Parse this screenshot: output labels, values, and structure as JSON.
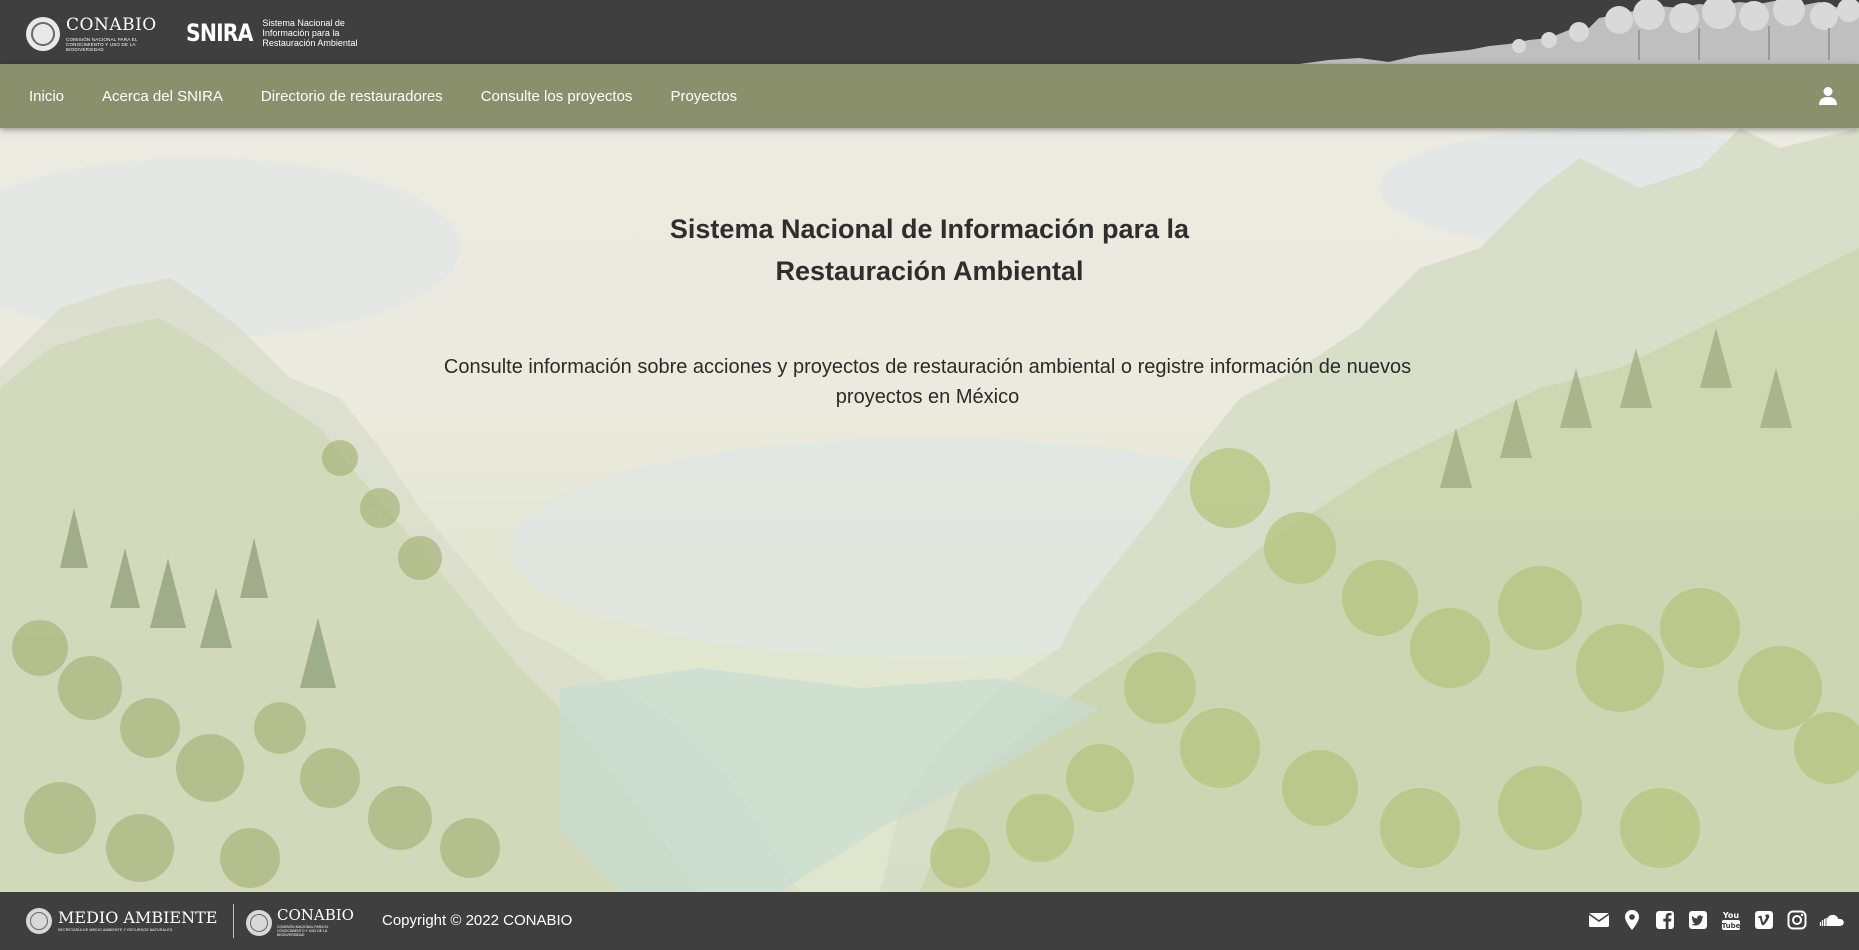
{
  "header": {
    "conabio_logo": {
      "word": "CONABIO",
      "sub": "COMISIÓN NACIONAL PARA EL CONOCIMIENTO Y USO DE LA BIODIVERSIDAD"
    },
    "snira_logo": {
      "word": "SNIRA",
      "sub": "Sistema Nacional de Información para la Restauración Ambiental"
    }
  },
  "nav": {
    "items": [
      {
        "label": "Inicio"
      },
      {
        "label": "Acerca del SNIRA"
      },
      {
        "label": "Directorio de restauradores"
      },
      {
        "label": "Consulte los proyectos"
      },
      {
        "label": "Proyectos"
      }
    ],
    "user_icon": "user-icon"
  },
  "hero": {
    "title_line1": "Sistema Nacional de Información para la",
    "title_line2": "Restauración Ambiental",
    "description": "Consulte información sobre acciones y proyectos de restauración ambiental o registre información de nuevos proyectos en México"
  },
  "footer": {
    "medio_ambiente": {
      "word": "MEDIO AMBIENTE",
      "sub": "SECRETARÍA DE MEDIO AMBIENTE Y RECURSOS NATURALES"
    },
    "conabio": {
      "word": "CONABIO",
      "sub": "COMISIÓN NACIONAL PARA EL CONOCIMIENTO Y USO DE LA BIODIVERSIDAD"
    },
    "copyright": "Copyright © 2022 CONABIO",
    "social_icons": [
      "envelope-icon",
      "map-pin-icon",
      "facebook-icon",
      "twitter-icon",
      "youtube-icon",
      "vimeo-icon",
      "instagram-icon",
      "soundcloud-icon"
    ]
  },
  "colors": {
    "header_bg": "#3f3f3f",
    "nav_bg": "#8a906b",
    "text_dark": "#2e2e2e"
  }
}
